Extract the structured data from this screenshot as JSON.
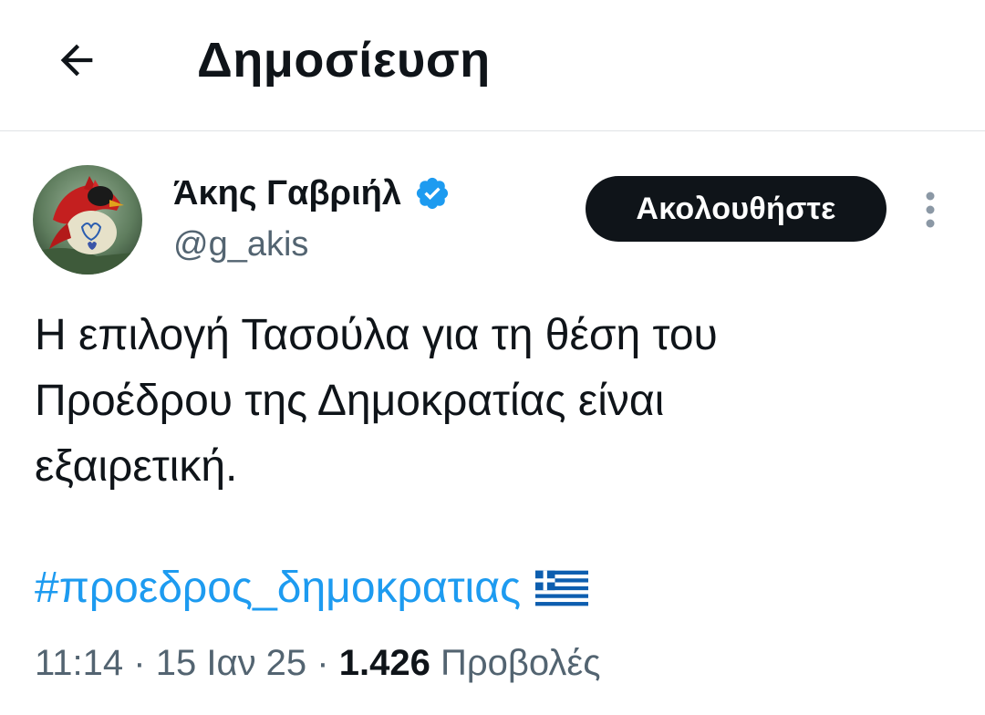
{
  "header": {
    "back_icon": "arrow-left-icon",
    "title": "Δημοσίευση"
  },
  "post": {
    "author": {
      "name": "Άκης Γαβριήλ",
      "handle": "@g_akis",
      "verified": true,
      "verified_icon": "verified-badge-icon",
      "avatar_icon": "red-bird-avatar"
    },
    "follow_label": "Ακολουθήστε",
    "more_icon": "more-vertical-icon",
    "text_lines": [
      "Η επιλογή Τασούλα για τη θέση του",
      "Προέδρου της Δημοκρατίας είναι",
      "εξαιρετική."
    ],
    "hashtag": "#προεδρος_δημοκρατιας",
    "flag_icon": "greek-flag-emoji",
    "time": "11:14",
    "date": "15 Ιαν 25",
    "separator": "·",
    "views_count": "1.426",
    "views_label": "Προβολές"
  },
  "colors": {
    "text": "#0f1419",
    "secondary": "#536471",
    "link": "#1d9bf0",
    "follow_bg": "#0f1419",
    "verified": "#1d9bf0",
    "divider": "#dfe3e6"
  }
}
